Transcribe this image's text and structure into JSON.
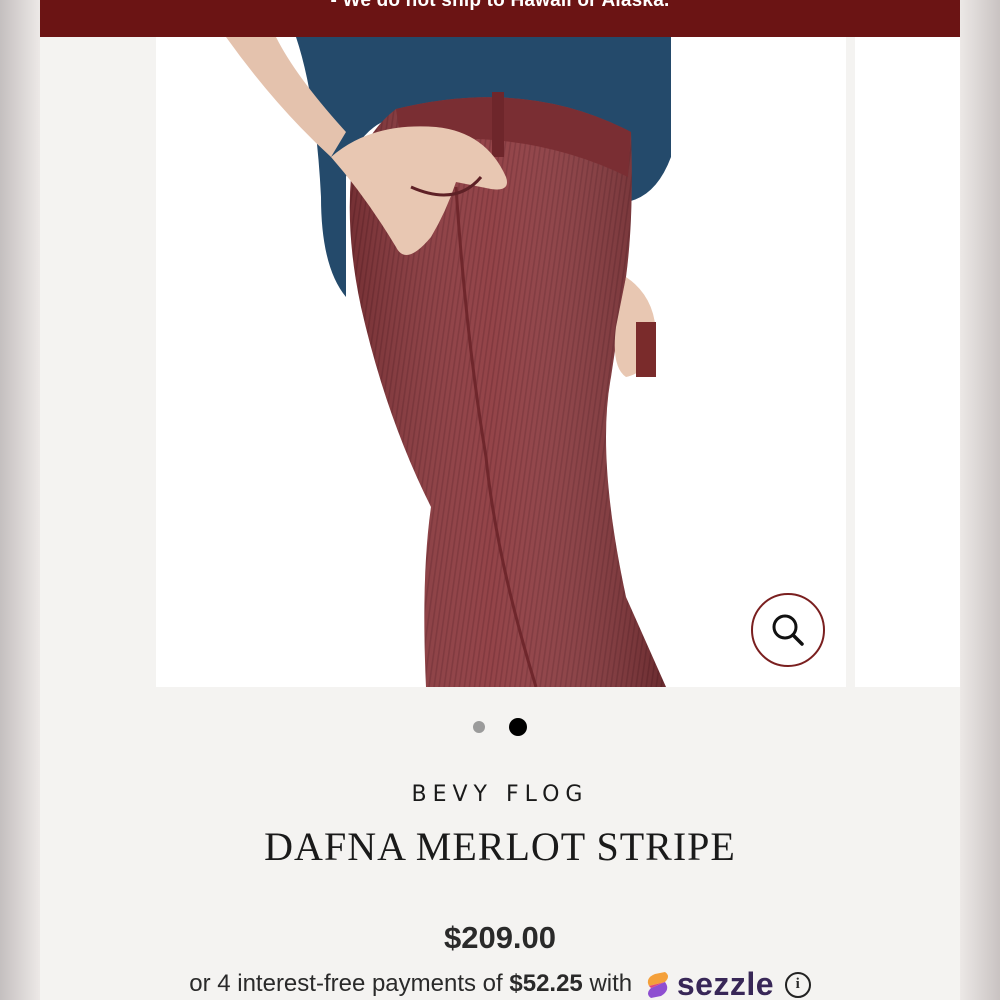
{
  "announcement": {
    "text": "- We do not ship to Hawaii or Alaska."
  },
  "gallery": {
    "zoom_icon": "search-icon",
    "slide_count": 2,
    "active_slide": 2
  },
  "product": {
    "brand": "BEVY FLOG",
    "title": "DAFNA MERLOT STRIPE",
    "price": "$209.00"
  },
  "payment": {
    "prefix": "or 4 interest-free payments of ",
    "amount": "$52.25",
    "with_text": " with",
    "provider": "sezzle",
    "info_icon": "info-icon"
  },
  "colors": {
    "announcement_bg": "#6b1414",
    "accent": "#7a1f1f",
    "pants": "#8e3a3f",
    "shirt": "#244a6b",
    "sezzle_purple": "#382757"
  }
}
